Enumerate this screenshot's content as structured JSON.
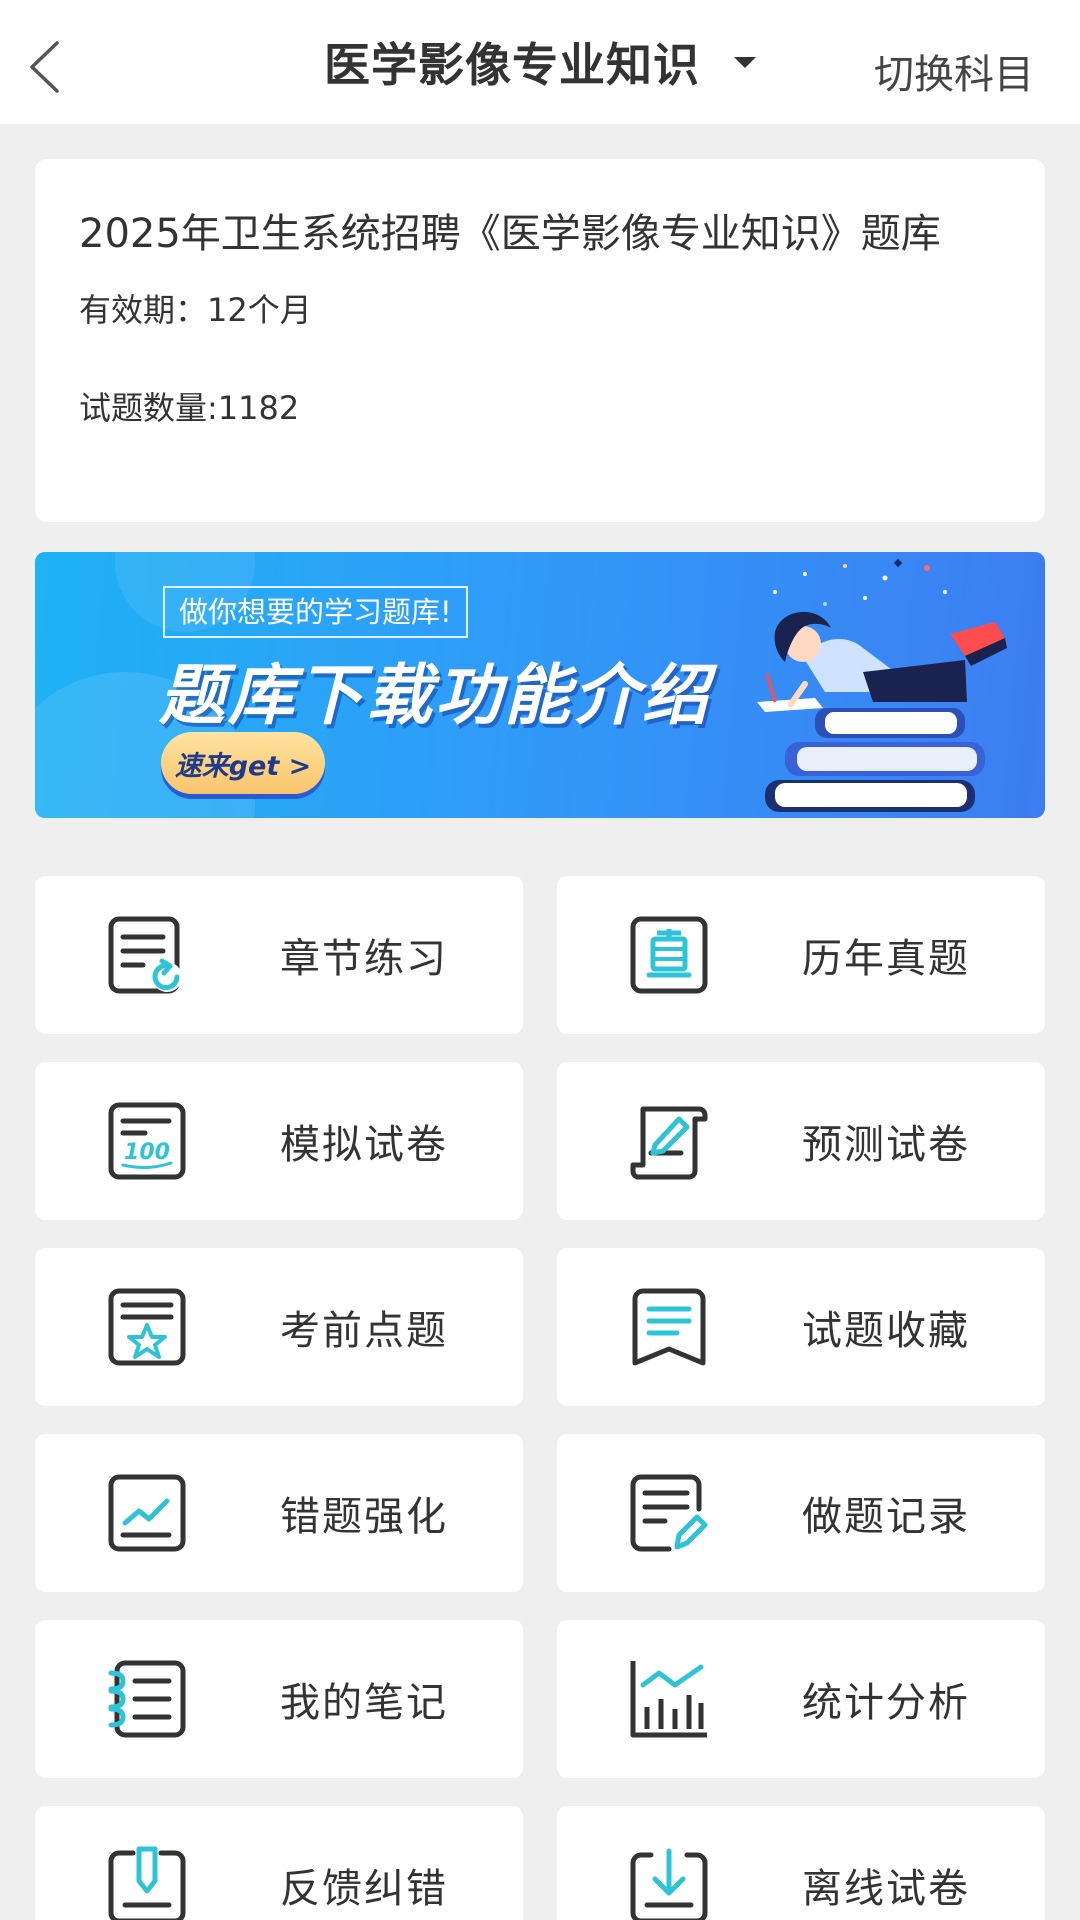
{
  "header": {
    "title": "医学影像专业知识",
    "switch_label": "切换科目"
  },
  "info": {
    "title": "2025年卫生系统招聘《医学影像专业知识》题库",
    "validity": "有效期：12个月",
    "count": "试题数量:1182"
  },
  "banner": {
    "tag": "做你想要的学习题库!",
    "heading": "题库下载功能介绍",
    "cta": "速来get >"
  },
  "features": [
    {
      "label": "章节练习",
      "icon": "chapter-practice-icon"
    },
    {
      "label": "历年真题",
      "icon": "past-exams-icon"
    },
    {
      "label": "模拟试卷",
      "icon": "mock-paper-icon"
    },
    {
      "label": "预测试卷",
      "icon": "prediction-paper-icon"
    },
    {
      "label": "考前点题",
      "icon": "pre-exam-tips-icon"
    },
    {
      "label": "试题收藏",
      "icon": "bookmark-icon"
    },
    {
      "label": "错题强化",
      "icon": "wrong-questions-icon"
    },
    {
      "label": "做题记录",
      "icon": "practice-record-icon"
    },
    {
      "label": "我的笔记",
      "icon": "notes-icon"
    },
    {
      "label": "统计分析",
      "icon": "statistics-icon"
    },
    {
      "label": "反馈纠错",
      "icon": "feedback-icon"
    },
    {
      "label": "离线试卷",
      "icon": "offline-download-icon"
    }
  ],
  "colors": {
    "accent": "#2ec4d6",
    "icon_stroke": "#333333",
    "banner_start": "#1fb2f5",
    "banner_end": "#3d7df2"
  }
}
